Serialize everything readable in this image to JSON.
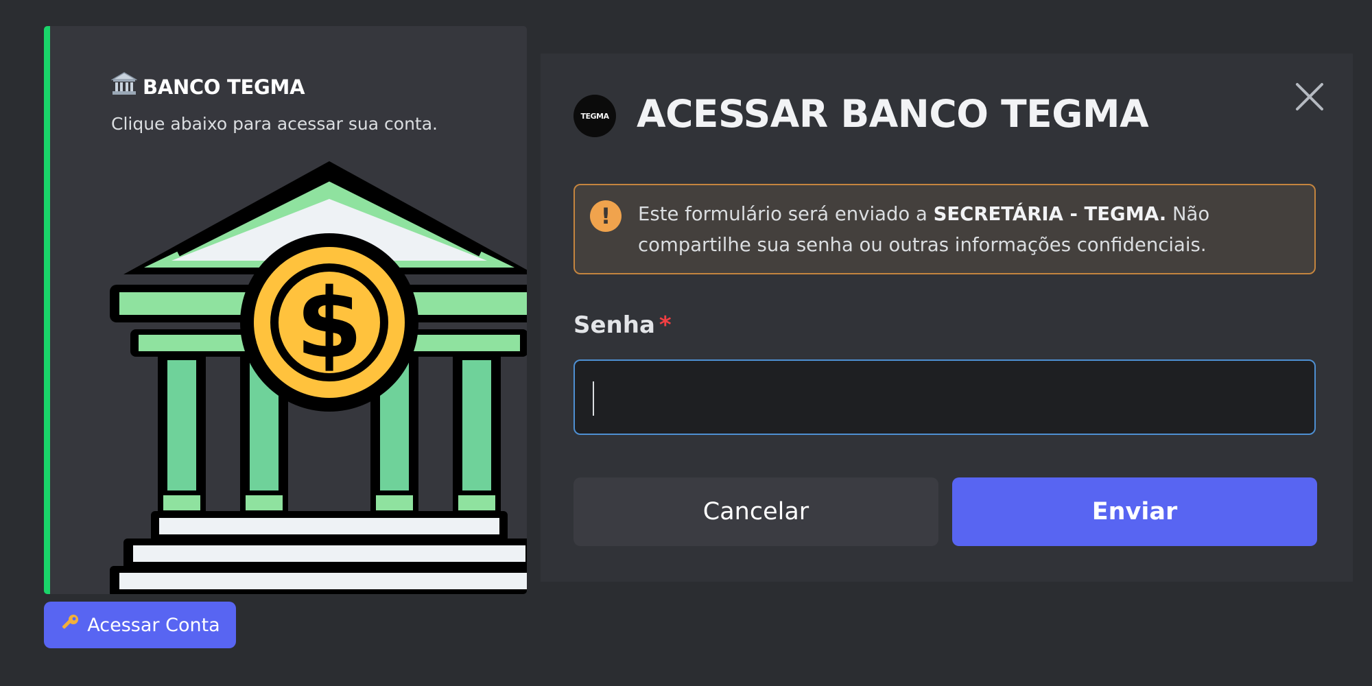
{
  "embed": {
    "title": "BANCO TEGMA",
    "title_icon": "bank-icon",
    "description": "Clique abaixo para acessar sua conta.",
    "image": "bank-building-dollar-icon",
    "accent_color": "#1ad46a"
  },
  "access_button": {
    "label": "Acessar Conta",
    "icon": "key-icon",
    "color": "#5865f2"
  },
  "modal": {
    "logo_text": "TEGMA",
    "title": "ACESSAR BANCO TEGMA",
    "close_icon": "close-icon",
    "warning": {
      "icon": "exclamation-icon",
      "text_before": "Este formulário será enviado a ",
      "recipient": "SECRETÁRIA - TEGMA.",
      "text_after": " Não compartilhe sua senha ou outras informações confidenciais.",
      "border_color": "#c5853f"
    },
    "field": {
      "label": "Senha",
      "required_mark": "*",
      "value": ""
    },
    "cancel_label": "Cancelar",
    "submit_label": "Enviar"
  }
}
